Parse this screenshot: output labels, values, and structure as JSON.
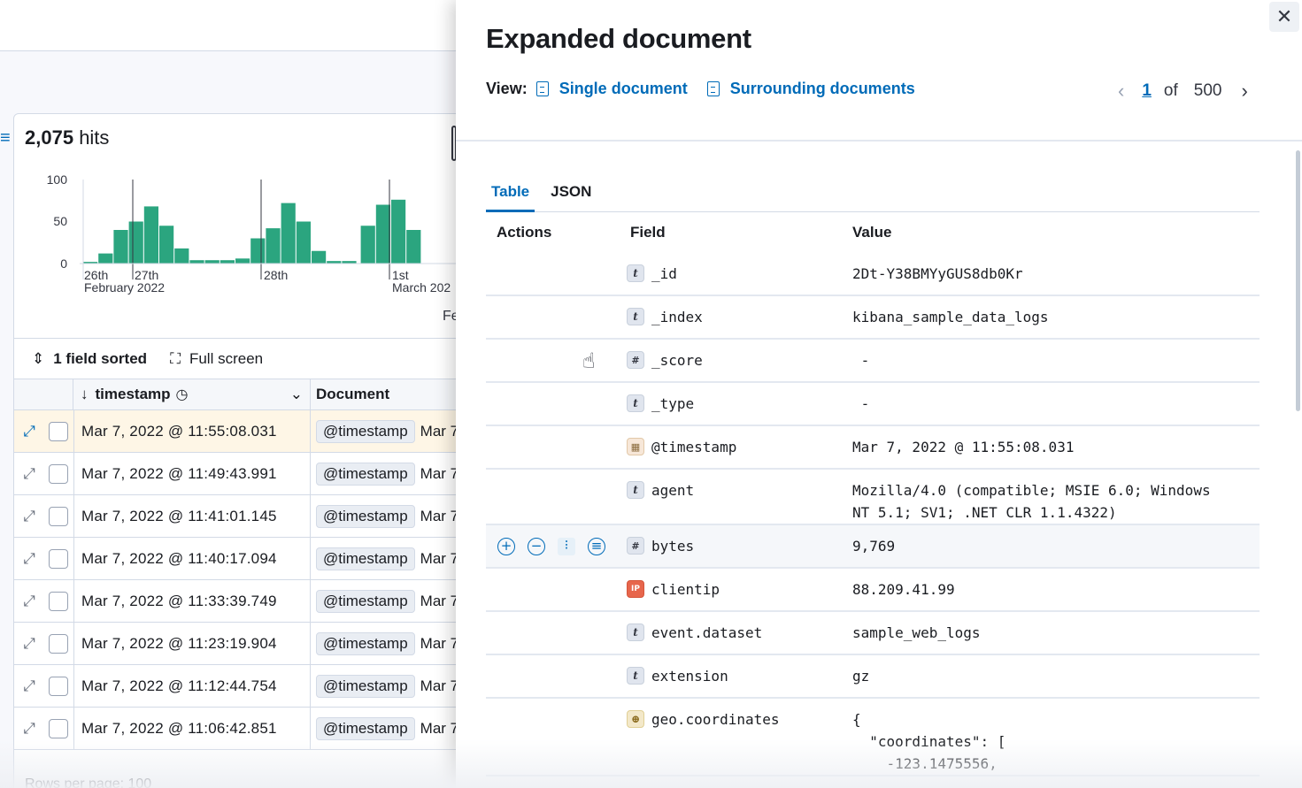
{
  "discover": {
    "hits_count": "2,075",
    "hits_label": "hits",
    "chart_data": {
      "type": "bar",
      "y_ticks": [
        "100",
        "50",
        "0"
      ],
      "x_tick_labels": [
        {
          "line1": "26th",
          "line2": "February 2022"
        },
        {
          "line1": "27th",
          "line2": ""
        },
        {
          "line1": "28th",
          "line2": ""
        },
        {
          "line1": "1st",
          "line2": "March 202"
        }
      ],
      "trailing_label": "Fe",
      "ylim": [
        0,
        100
      ],
      "values": [
        2,
        12,
        40,
        50,
        68,
        45,
        18,
        4,
        4,
        4,
        6,
        30,
        42,
        72,
        50,
        15,
        3,
        3,
        45,
        70,
        76,
        40
      ],
      "bar_color": "#2ba57f"
    },
    "toolbar": {
      "sort_label": "1 field sorted",
      "fullscreen_label": "Full screen"
    },
    "grid": {
      "col_timestamp": "timestamp",
      "col_document": "Document",
      "rows": [
        {
          "ts": "Mar 7, 2022 @ 11:55:08.031",
          "pill": "@timestamp",
          "doc": "Mar 7"
        },
        {
          "ts": "Mar 7, 2022 @ 11:49:43.991",
          "pill": "@timestamp",
          "doc": "Mar 7"
        },
        {
          "ts": "Mar 7, 2022 @ 11:41:01.145",
          "pill": "@timestamp",
          "doc": "Mar 7"
        },
        {
          "ts": "Mar 7, 2022 @ 11:40:17.094",
          "pill": "@timestamp",
          "doc": "Mar 7"
        },
        {
          "ts": "Mar 7, 2022 @ 11:33:39.749",
          "pill": "@timestamp",
          "doc": "Mar 7"
        },
        {
          "ts": "Mar 7, 2022 @ 11:23:19.904",
          "pill": "@timestamp",
          "doc": "Mar 7"
        },
        {
          "ts": "Mar 7, 2022 @ 11:12:44.754",
          "pill": "@timestamp",
          "doc": "Mar 7"
        },
        {
          "ts": "Mar 7, 2022 @ 11:06:42.851",
          "pill": "@timestamp",
          "doc": "Mar 7"
        }
      ]
    },
    "rows_per_page": "Rows per page: 100"
  },
  "flyout": {
    "title": "Expanded document",
    "view_label": "View:",
    "single_doc": "Single document",
    "surrounding_docs": "Surrounding documents",
    "pager": {
      "current": "1",
      "of": "of",
      "total": "500"
    },
    "tabs": [
      "Table",
      "JSON"
    ],
    "table_headers": {
      "actions": "Actions",
      "field": "Field",
      "value": "Value"
    },
    "rows": [
      {
        "type": "t",
        "field": "_id",
        "value": "2Dt-Y38BMYyGUS8db0Kr"
      },
      {
        "type": "t",
        "field": "_index",
        "value": "kibana_sample_data_logs"
      },
      {
        "type": "#",
        "field": "_score",
        "value": " -"
      },
      {
        "type": "t",
        "field": "_type",
        "value": " -"
      },
      {
        "type": "date",
        "field": "@timestamp",
        "value": "Mar 7, 2022 @ 11:55:08.031"
      },
      {
        "type": "t",
        "field": "agent",
        "value": "Mozilla/4.0 (compatible; MSIE 6.0; Windows\nNT 5.1; SV1; .NET CLR 1.1.4322)"
      },
      {
        "type": "#",
        "field": "bytes",
        "value": "9,769"
      },
      {
        "type": "ip",
        "field": "clientip",
        "value": "88.209.41.99"
      },
      {
        "type": "t",
        "field": "event.dataset",
        "value": "sample_web_logs"
      },
      {
        "type": "t",
        "field": "extension",
        "value": "gz"
      },
      {
        "type": "geo",
        "field": "geo.coordinates",
        "value": "{\n  \"coordinates\": [\n    -123.1475556,"
      }
    ]
  }
}
